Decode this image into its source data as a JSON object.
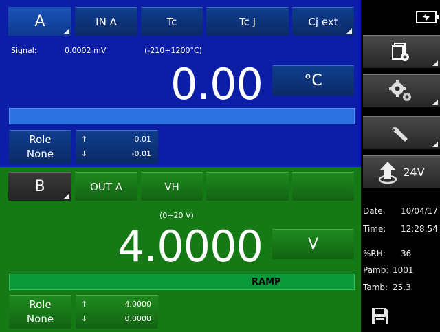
{
  "channel_a": {
    "tabs": [
      "A",
      "IN A",
      "Tc",
      "Tc J",
      "Cj ext"
    ],
    "signal_label": "Signal:",
    "signal_value": "0.0002 mV",
    "range": "(-210÷1200°C)",
    "reading": "0.00",
    "unit": "°C",
    "role_line1": "Role",
    "role_line2": "None",
    "limit_high_arrow": "↑",
    "limit_high": "0.01",
    "limit_low_arrow": "↓",
    "limit_low": "-0.01"
  },
  "channel_b": {
    "tabs": [
      "B",
      "OUT A",
      "VH",
      "",
      ""
    ],
    "range": "(0÷20 V)",
    "reading": "4.0000",
    "unit": "V",
    "bar_label": "RAMP",
    "role_line1": "Role",
    "role_line2": "None",
    "limit_high_arrow": "↑",
    "limit_high": "4.0000",
    "limit_low_arrow": "↓",
    "limit_low": "0.0000"
  },
  "sidebar": {
    "power_label": "24V",
    "date_label": "Date:",
    "date_value": "10/04/17",
    "time_label": "Time:",
    "time_value": "12:28:54",
    "rh_label": "%RH:",
    "rh_value": "36",
    "pamb_label": "Pamb:",
    "pamb_value": "1001",
    "tamb_label": "Tamb:",
    "tamb_value": "25.3",
    "icons": [
      "battery-plug-icon",
      "file-settings-icon",
      "gears-icon",
      "wrench-icon",
      "loop-power-icon",
      "save-icon"
    ]
  },
  "colors": {
    "channel_a_bg": "#0c1ea6",
    "channel_b_bg": "#157a16",
    "sidebar_bg": "#000000"
  }
}
